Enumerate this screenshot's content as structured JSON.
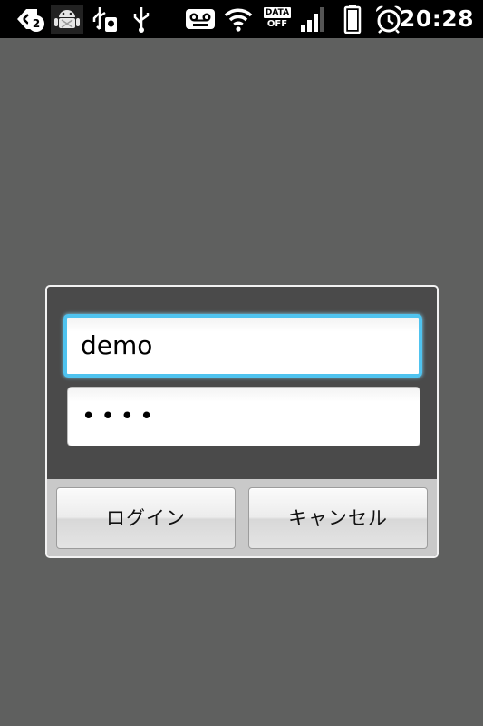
{
  "status_bar": {
    "icons": [
      "notification-back-icon",
      "android-debug-icon",
      "usb-storage-icon",
      "usb-icon",
      "voicemail-icon",
      "wifi-icon",
      "data-off-icon",
      "signal-icon",
      "battery-icon",
      "alarm-icon"
    ],
    "notification_count": "2",
    "data_label_top": "DATA",
    "data_label_bottom": "OFF",
    "time": "20:28"
  },
  "login_dialog": {
    "username_value": "demo",
    "password_value": "••••",
    "login_label": "ログイン",
    "cancel_label": "キャンセル"
  },
  "colors": {
    "focus_border": "#4fc3ef",
    "background": "#5f605f",
    "dialog_background": "#4a4a4a",
    "button_bar": "#c9c9c9"
  }
}
